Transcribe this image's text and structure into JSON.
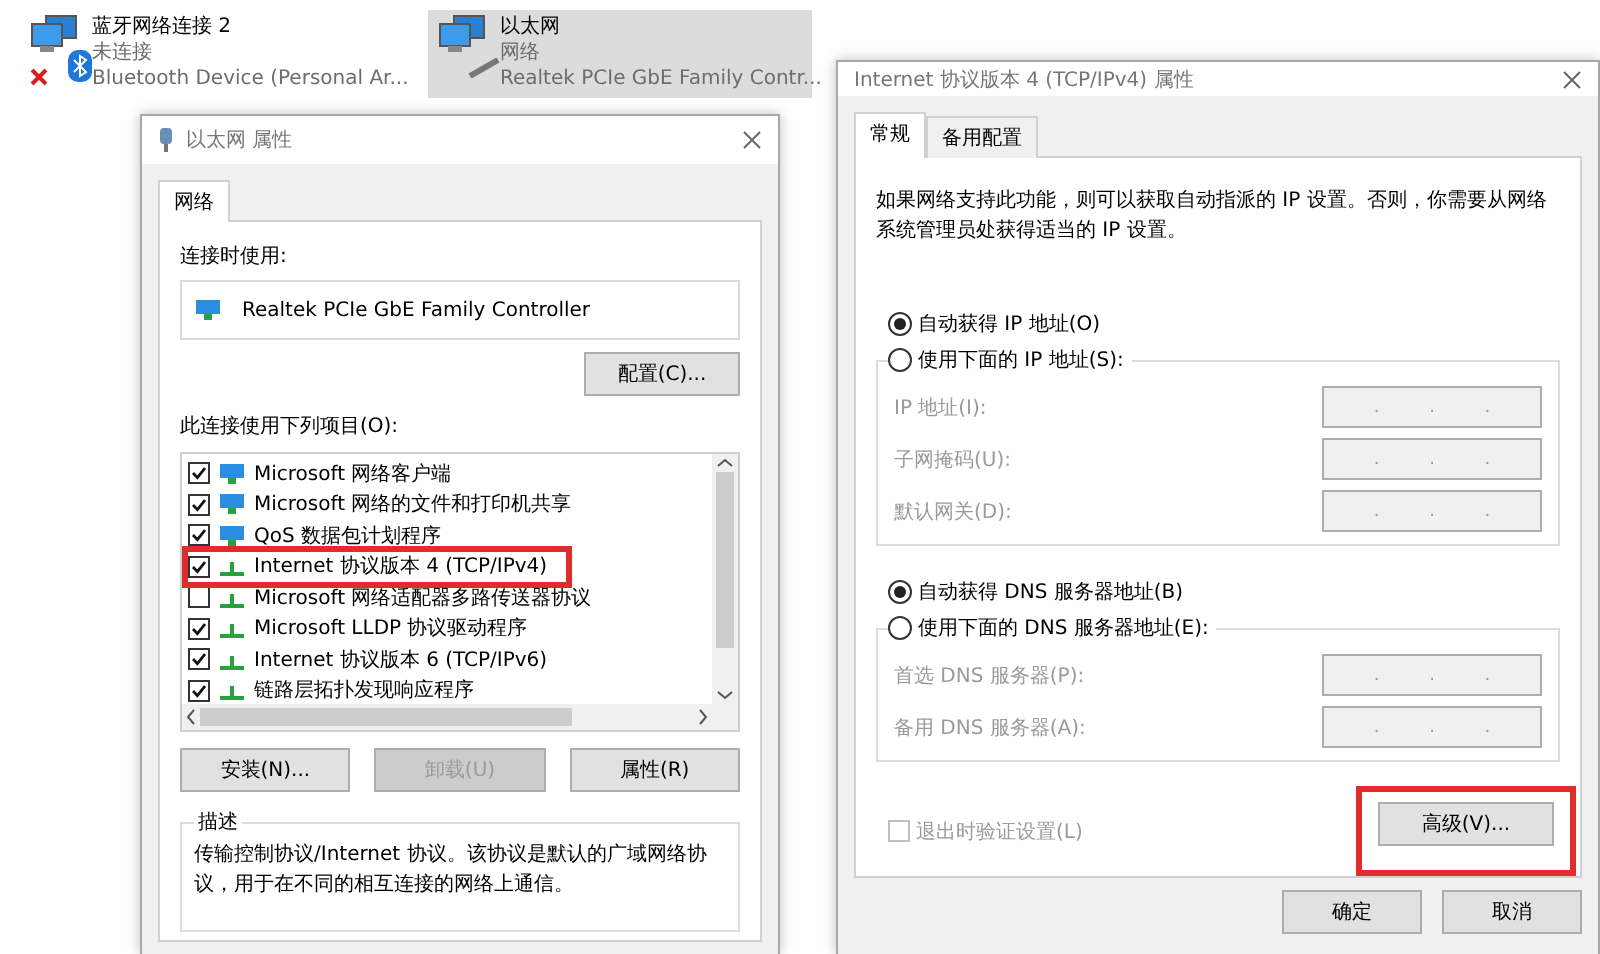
{
  "adapters": [
    {
      "kind": "bluetooth",
      "name": "蓝牙网络连接 2",
      "status": "未连接",
      "device": "Bluetooth Device (Personal Ar...",
      "selected": false,
      "disconnected": true
    },
    {
      "kind": "ethernet",
      "name": "以太网",
      "status": "网络",
      "device": "Realtek PCIe GbE Family Contr...",
      "selected": true,
      "disconnected": false
    }
  ],
  "properties_dialog": {
    "title": "以太网 属性",
    "tabs": [
      {
        "label": "网络",
        "selected": true
      }
    ],
    "connect_using_label": "连接时使用:",
    "adapter": "Realtek PCIe GbE Family Controller",
    "configure_button": "配置(C)...",
    "items_label": "此连接使用下列项目(O):",
    "items": [
      {
        "kind": "client",
        "label": "Microsoft 网络客户端",
        "checked": true,
        "highlighted": false
      },
      {
        "kind": "client",
        "label": "Microsoft 网络的文件和打印机共享",
        "checked": true,
        "highlighted": false
      },
      {
        "kind": "client",
        "label": "QoS 数据包计划程序",
        "checked": true,
        "highlighted": false
      },
      {
        "kind": "protocol",
        "label": "Internet 协议版本 4 (TCP/IPv4)",
        "checked": true,
        "highlighted": true
      },
      {
        "kind": "protocol",
        "label": "Microsoft 网络适配器多路传送器协议",
        "checked": false,
        "highlighted": false
      },
      {
        "kind": "protocol",
        "label": "Microsoft LLDP 协议驱动程序",
        "checked": true,
        "highlighted": false
      },
      {
        "kind": "protocol",
        "label": "Internet 协议版本 6 (TCP/IPv6)",
        "checked": true,
        "highlighted": false
      },
      {
        "kind": "protocol",
        "label": "链路层拓扑发现响应程序",
        "checked": true,
        "highlighted": false
      }
    ],
    "buttons": [
      {
        "label": "安装(N)...",
        "disabled": false
      },
      {
        "label": "卸载(U)",
        "disabled": true
      },
      {
        "label": "属性(R)",
        "disabled": false
      }
    ],
    "description_label": "描述",
    "description": "传输控制协议/Internet 协议。该协议是默认的广域网络协议，用于在不同的相互连接的网络上通信。"
  },
  "ipv4_dialog": {
    "title": "Internet 协议版本 4 (TCP/IPv4) 属性",
    "tabs": [
      {
        "label": "常规",
        "selected": true
      },
      {
        "label": "备用配置",
        "selected": false
      }
    ],
    "intro": "如果网络支持此功能，则可以获取自动指派的 IP 设置。否则，你需要从网络系统管理员处获得适当的 IP 设置。",
    "ip_options": [
      {
        "label": "自动获得 IP 地址(O)",
        "selected": true
      },
      {
        "label": "使用下面的 IP 地址(S):",
        "selected": false
      }
    ],
    "ip_fields": [
      {
        "label": "IP 地址(I):",
        "separators": [
          ".",
          ".",
          "."
        ]
      },
      {
        "label": "子网掩码(U):",
        "separators": [
          ".",
          ".",
          "."
        ]
      },
      {
        "label": "默认网关(D):",
        "separators": [
          ".",
          ".",
          "."
        ]
      }
    ],
    "dns_options": [
      {
        "label": "自动获得 DNS 服务器地址(B)",
        "selected": true
      },
      {
        "label": "使用下面的 DNS 服务器地址(E):",
        "selected": false
      }
    ],
    "dns_fields": [
      {
        "label": "首选 DNS 服务器(P):",
        "separators": [
          ".",
          ".",
          "."
        ]
      },
      {
        "label": "备用 DNS 服务器(A):",
        "separators": [
          ".",
          ".",
          "."
        ]
      }
    ],
    "validate": {
      "label": "退出时验证设置(L)",
      "checked": false,
      "disabled": true
    },
    "advanced_button": {
      "label": "高级(V)...",
      "highlighted": true
    },
    "buttons": [
      "确定",
      "取消"
    ]
  }
}
